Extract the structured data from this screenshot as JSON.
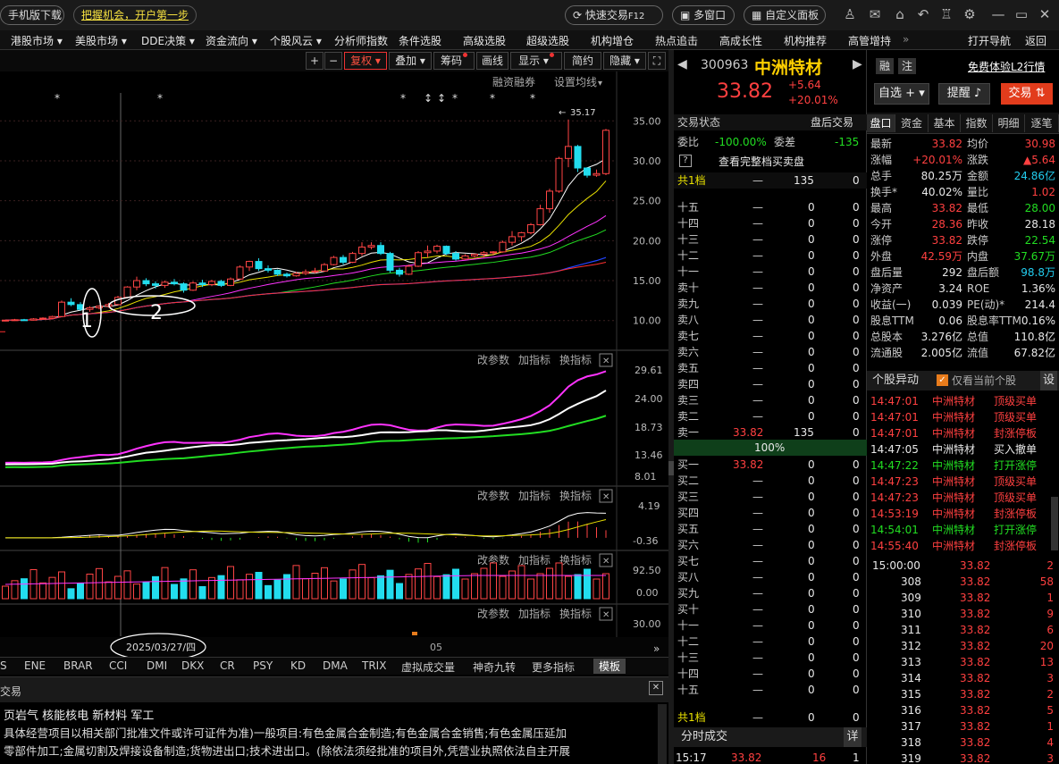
{
  "topbar": {
    "mobile": "手机版下载",
    "slogan": "把握机会，开户第一步",
    "fast_trade": "快速交易",
    "fast_key": "F12",
    "multi": "多窗口",
    "custom": "自定义面板"
  },
  "menu": [
    "港股市场",
    "美股市场",
    "DDE决策",
    "资金流向",
    "个股风云",
    "分析师指数",
    "条件选股",
    "高级选股",
    "超级选股",
    "机构增仓",
    "热点追击",
    "高成长性",
    "机构推荐",
    "高管增持",
    "打开导航",
    "返回"
  ],
  "chart_toolbar": {
    "plus": "+",
    "minus": "−",
    "fuquan": "复权",
    "diejia": "叠加",
    "chouma": "筹码",
    "huaxian": "画线",
    "xianshi": "显示",
    "jianyue": "简约",
    "yincang": "隐藏",
    "rongzi": "融资融券",
    "junxian": "设置均线"
  },
  "stock": {
    "code": "300963",
    "name": "中洲特材",
    "price": "33.82",
    "change": "+5.64",
    "pct": "+20.01%",
    "rong": "融",
    "zhu": "注",
    "free_l2": "免费体验L2行情",
    "zixuan": "自选",
    "tixing": "提醒",
    "jiaoyi": "交易"
  },
  "chart": {
    "yticks": [
      "35.00",
      "30.00",
      "25.00",
      "20.00",
      "15.00",
      "10.00"
    ],
    "high_label": "35.17",
    "annot1": "1",
    "annot2": "2",
    "date": "2025/03/27/四",
    "month": "05",
    "panel_btns": [
      "改参数",
      "加指标",
      "换指标"
    ],
    "p2ticks": [
      "29.61",
      "24.00",
      "18.73",
      "13.46",
      "8.01"
    ],
    "p3ticks": [
      "4.19",
      "-0.36"
    ],
    "p4ticks": [
      "92.50",
      "0.00"
    ],
    "p5ticks": [
      "30.00"
    ],
    "markers": [
      "*",
      "*",
      "*",
      "↕",
      "↕",
      "*",
      "*",
      "*",
      "*"
    ]
  },
  "chart_data": {
    "type": "candlestick",
    "candles": [
      [
        10,
        10.1,
        9.9,
        10.05
      ],
      [
        10.05,
        10.2,
        10,
        10.1
      ],
      [
        10.1,
        10.2,
        10,
        10.05
      ],
      [
        10.05,
        10.3,
        10,
        10.2
      ],
      [
        10.2,
        10.4,
        10.1,
        10.3
      ],
      [
        10.3,
        10.6,
        10.2,
        10.5
      ],
      [
        10.5,
        12.5,
        10.4,
        12.3
      ],
      [
        12.3,
        12.8,
        11.8,
        12
      ],
      [
        12,
        12.3,
        11.2,
        11.4
      ],
      [
        11.4,
        11.8,
        11.1,
        11.6
      ],
      [
        11.6,
        11.9,
        11.4,
        11.8
      ],
      [
        11.8,
        12.2,
        11.6,
        12
      ],
      [
        12,
        13.1,
        11.9,
        12.9
      ],
      [
        12.9,
        14.3,
        12.8,
        14.2
      ],
      [
        14.2,
        15.5,
        13.8,
        15
      ],
      [
        15,
        15.3,
        14.3,
        14.6
      ],
      [
        14.6,
        14.9,
        14,
        14.4
      ],
      [
        14.4,
        15,
        14.1,
        14.8
      ],
      [
        14.8,
        15.2,
        14.4,
        14.6
      ],
      [
        14.6,
        14.8,
        13.5,
        13.8
      ],
      [
        13.8,
        14.9,
        13.7,
        14.7
      ],
      [
        14.7,
        15.1,
        14.2,
        14.5
      ],
      [
        14.5,
        15.1,
        14.3,
        14.9
      ],
      [
        14.9,
        15.1,
        14.2,
        14.4
      ],
      [
        14.4,
        15.4,
        14.3,
        15.2
      ],
      [
        15.2,
        16.9,
        15.1,
        16.7
      ],
      [
        16.7,
        17.5,
        16.2,
        17.4
      ],
      [
        17.4,
        17.8,
        16.2,
        16.5
      ],
      [
        16.5,
        16.9,
        16,
        16.3
      ],
      [
        16.3,
        16.4,
        15.6,
        15.8
      ],
      [
        15.8,
        16,
        15.4,
        15.6
      ],
      [
        15.6,
        16.1,
        15.5,
        15.9
      ],
      [
        15.9,
        16.4,
        15.7,
        16.1
      ],
      [
        16.1,
        16.6,
        15.9,
        16.2
      ],
      [
        16.2,
        17.2,
        16.1,
        17
      ],
      [
        17,
        18.1,
        16.9,
        17.9
      ],
      [
        17.9,
        18.2,
        17,
        17.3
      ],
      [
        17.3,
        18.6,
        17.2,
        18.4
      ],
      [
        18.4,
        19.8,
        18.1,
        19.2
      ],
      [
        19.2,
        19.8,
        18.9,
        19.4
      ],
      [
        19.4,
        19.8,
        18.2,
        18.4
      ],
      [
        18.4,
        18.6,
        16,
        16.3
      ],
      [
        16.3,
        16.6,
        15.5,
        15.8
      ],
      [
        15.8,
        17,
        15.7,
        16.8
      ],
      [
        16.8,
        18.7,
        16.7,
        18.5
      ],
      [
        18.5,
        19.4,
        17.9,
        18.7
      ],
      [
        18.7,
        19.5,
        18.4,
        19.3
      ],
      [
        19.3,
        19.4,
        18.2,
        18.4
      ],
      [
        18.4,
        18.7,
        17.5,
        17.7
      ],
      [
        17.7,
        18.3,
        17.6,
        18.1
      ],
      [
        18.1,
        18.3,
        17.9,
        18.3
      ],
      [
        18.3,
        18.7,
        17.9,
        18.5
      ],
      [
        18.5,
        18.7,
        18.2,
        18.6
      ],
      [
        18.6,
        20,
        18.5,
        19.8
      ],
      [
        19.8,
        21.2,
        19.4,
        20.5
      ],
      [
        20.5,
        21.1,
        19.9,
        21
      ],
      [
        21,
        22.2,
        20.8,
        22
      ],
      [
        22,
        24.5,
        21.9,
        24
      ],
      [
        24,
        26.5,
        23.5,
        26.2
      ],
      [
        26.2,
        30.5,
        26,
        30.3
      ],
      [
        30.3,
        35.17,
        29.2,
        31.8
      ],
      [
        31.8,
        32,
        28.6,
        29.1
      ],
      [
        29.1,
        29.2,
        27.9,
        28.2
      ],
      [
        28.2,
        28.9,
        28,
        28.4
      ],
      [
        28.4,
        34,
        28.2,
        33.82
      ]
    ]
  },
  "order_book": {
    "status": "交易状态",
    "after": "盘后交易",
    "weibi_l": "委比",
    "weibi_v": "-100.00%",
    "weicha_l": "委差",
    "weicha_v": "-135",
    "view_full": "查看完整档买卖盘",
    "total1": "共1档",
    "total1_vol": "135",
    "total1_n": "0",
    "sells": [
      [
        "十五",
        "—",
        "0",
        "0"
      ],
      [
        "十四",
        "—",
        "0",
        "0"
      ],
      [
        "十三",
        "—",
        "0",
        "0"
      ],
      [
        "十二",
        "—",
        "0",
        "0"
      ],
      [
        "十一",
        "—",
        "0",
        "0"
      ],
      [
        "卖十",
        "—",
        "0",
        "0"
      ],
      [
        "卖九",
        "—",
        "0",
        "0"
      ],
      [
        "卖八",
        "—",
        "0",
        "0"
      ],
      [
        "卖七",
        "—",
        "0",
        "0"
      ],
      [
        "卖六",
        "—",
        "0",
        "0"
      ],
      [
        "卖五",
        "—",
        "0",
        "0"
      ],
      [
        "卖四",
        "—",
        "0",
        "0"
      ],
      [
        "卖三",
        "—",
        "0",
        "0"
      ],
      [
        "卖二",
        "—",
        "0",
        "0"
      ],
      [
        "卖一",
        "33.82",
        "135",
        "0"
      ]
    ],
    "ratio": "100%",
    "buys": [
      [
        "买一",
        "33.82",
        "0",
        "0"
      ],
      [
        "买二",
        "—",
        "0",
        "0"
      ],
      [
        "买三",
        "—",
        "0",
        "0"
      ],
      [
        "买四",
        "—",
        "0",
        "0"
      ],
      [
        "买五",
        "—",
        "0",
        "0"
      ],
      [
        "买六",
        "—",
        "0",
        "0"
      ],
      [
        "买七",
        "—",
        "0",
        "0"
      ],
      [
        "买八",
        "—",
        "0",
        "0"
      ],
      [
        "买九",
        "—",
        "0",
        "0"
      ],
      [
        "买十",
        "—",
        "0",
        "0"
      ],
      [
        "十一",
        "—",
        "0",
        "0"
      ],
      [
        "十二",
        "—",
        "0",
        "0"
      ],
      [
        "十三",
        "—",
        "0",
        "0"
      ],
      [
        "十四",
        "—",
        "0",
        "0"
      ],
      [
        "十五",
        "—",
        "0",
        "0"
      ]
    ],
    "total2": "共1档",
    "total2_p": "—",
    "total2_v": "0",
    "total2_n": "0",
    "fenshi": "分时成交",
    "xiang": "详",
    "last_time": "15:17",
    "last_price": "33.82",
    "last_vol": "16",
    "last_n": "1"
  },
  "stats_tabs": [
    "盘口",
    "资金",
    "基本",
    "指数",
    "明细",
    "逐笔"
  ],
  "stats": [
    [
      "最新",
      "33.82",
      "均价",
      "30.98"
    ],
    [
      "涨幅",
      "+20.01%",
      "涨跌",
      "▲5.64"
    ],
    [
      "总手",
      "80.25万",
      "金额",
      "24.86亿"
    ],
    [
      "换手*",
      "40.02%",
      "量比",
      "1.02"
    ],
    [
      "最高",
      "33.82",
      "最低",
      "28.00"
    ],
    [
      "今开",
      "28.36",
      "昨收",
      "28.18"
    ],
    [
      "涨停",
      "33.82",
      "跌停",
      "22.54"
    ],
    [
      "外盘",
      "42.59万",
      "内盘",
      "37.67万"
    ],
    [
      "盘后量",
      "292",
      "盘后额",
      "98.8万"
    ],
    [
      "净资产",
      "3.24",
      "ROE",
      "1.36%"
    ],
    [
      "收益(一)",
      "0.039",
      "PE(动)*",
      "214.4"
    ],
    [
      "股息TTM",
      "0.06",
      "股息率TTM",
      "0.16%"
    ],
    [
      "总股本",
      "3.276亿",
      "总值",
      "110.8亿"
    ],
    [
      "流通股",
      "2.005亿",
      "流值",
      "67.82亿"
    ]
  ],
  "yidong": {
    "title": "个股异动",
    "only": "仅看当前个股",
    "set": "设",
    "rows": [
      [
        "14:47:01",
        "中洲特材",
        "顶级买单"
      ],
      [
        "14:47:01",
        "中洲特材",
        "顶级买单"
      ],
      [
        "14:47:01",
        "中洲特材",
        "封涨停板"
      ],
      [
        "14:47:05",
        "中洲特材",
        "买入撤单"
      ],
      [
        "14:47:22",
        "中洲特材",
        "打开涨停"
      ],
      [
        "14:47:23",
        "中洲特材",
        "顶级买单"
      ],
      [
        "14:47:23",
        "中洲特材",
        "顶级买单"
      ],
      [
        "14:53:19",
        "中洲特材",
        "封涨停板"
      ],
      [
        "14:54:01",
        "中洲特材",
        "打开涨停"
      ],
      [
        "14:55:40",
        "中洲特材",
        "封涨停板"
      ]
    ]
  },
  "ticks": [
    [
      "15:00:00",
      "33.82",
      "2"
    ],
    [
      "308",
      "33.82",
      "58"
    ],
    [
      "309",
      "33.82",
      "1"
    ],
    [
      "310",
      "33.82",
      "9"
    ],
    [
      "311",
      "33.82",
      "6"
    ],
    [
      "312",
      "33.82",
      "20"
    ],
    [
      "313",
      "33.82",
      "13"
    ],
    [
      "314",
      "33.82",
      "3"
    ],
    [
      "315",
      "33.82",
      "2"
    ],
    [
      "316",
      "33.82",
      "5"
    ],
    [
      "317",
      "33.82",
      "1"
    ],
    [
      "318",
      "33.82",
      "4"
    ],
    [
      "319",
      "33.82",
      "3"
    ]
  ],
  "index_tabs": [
    "S",
    "ENE",
    "BRAR",
    "CCI",
    "DMI",
    "DKX",
    "CR",
    "PSY",
    "KD",
    "DMA",
    "TRIX",
    "虚拟成交量",
    "神奇九转",
    "更多指标",
    "模板"
  ],
  "bottom": {
    "tab": "交易",
    "concepts": "页岩气 核能核电 新材料 军工",
    "line1": "具体经营项目以相关部门批准文件或许可证件为准)一般项目:有色金属合金制造;有色金属合金销售;有色金属压延加",
    "line2": "零部件加工;金属切割及焊接设备制造;货物进出口;技术进出口。(除依法须经批准的项目外,凭营业执照依法自主开展"
  }
}
